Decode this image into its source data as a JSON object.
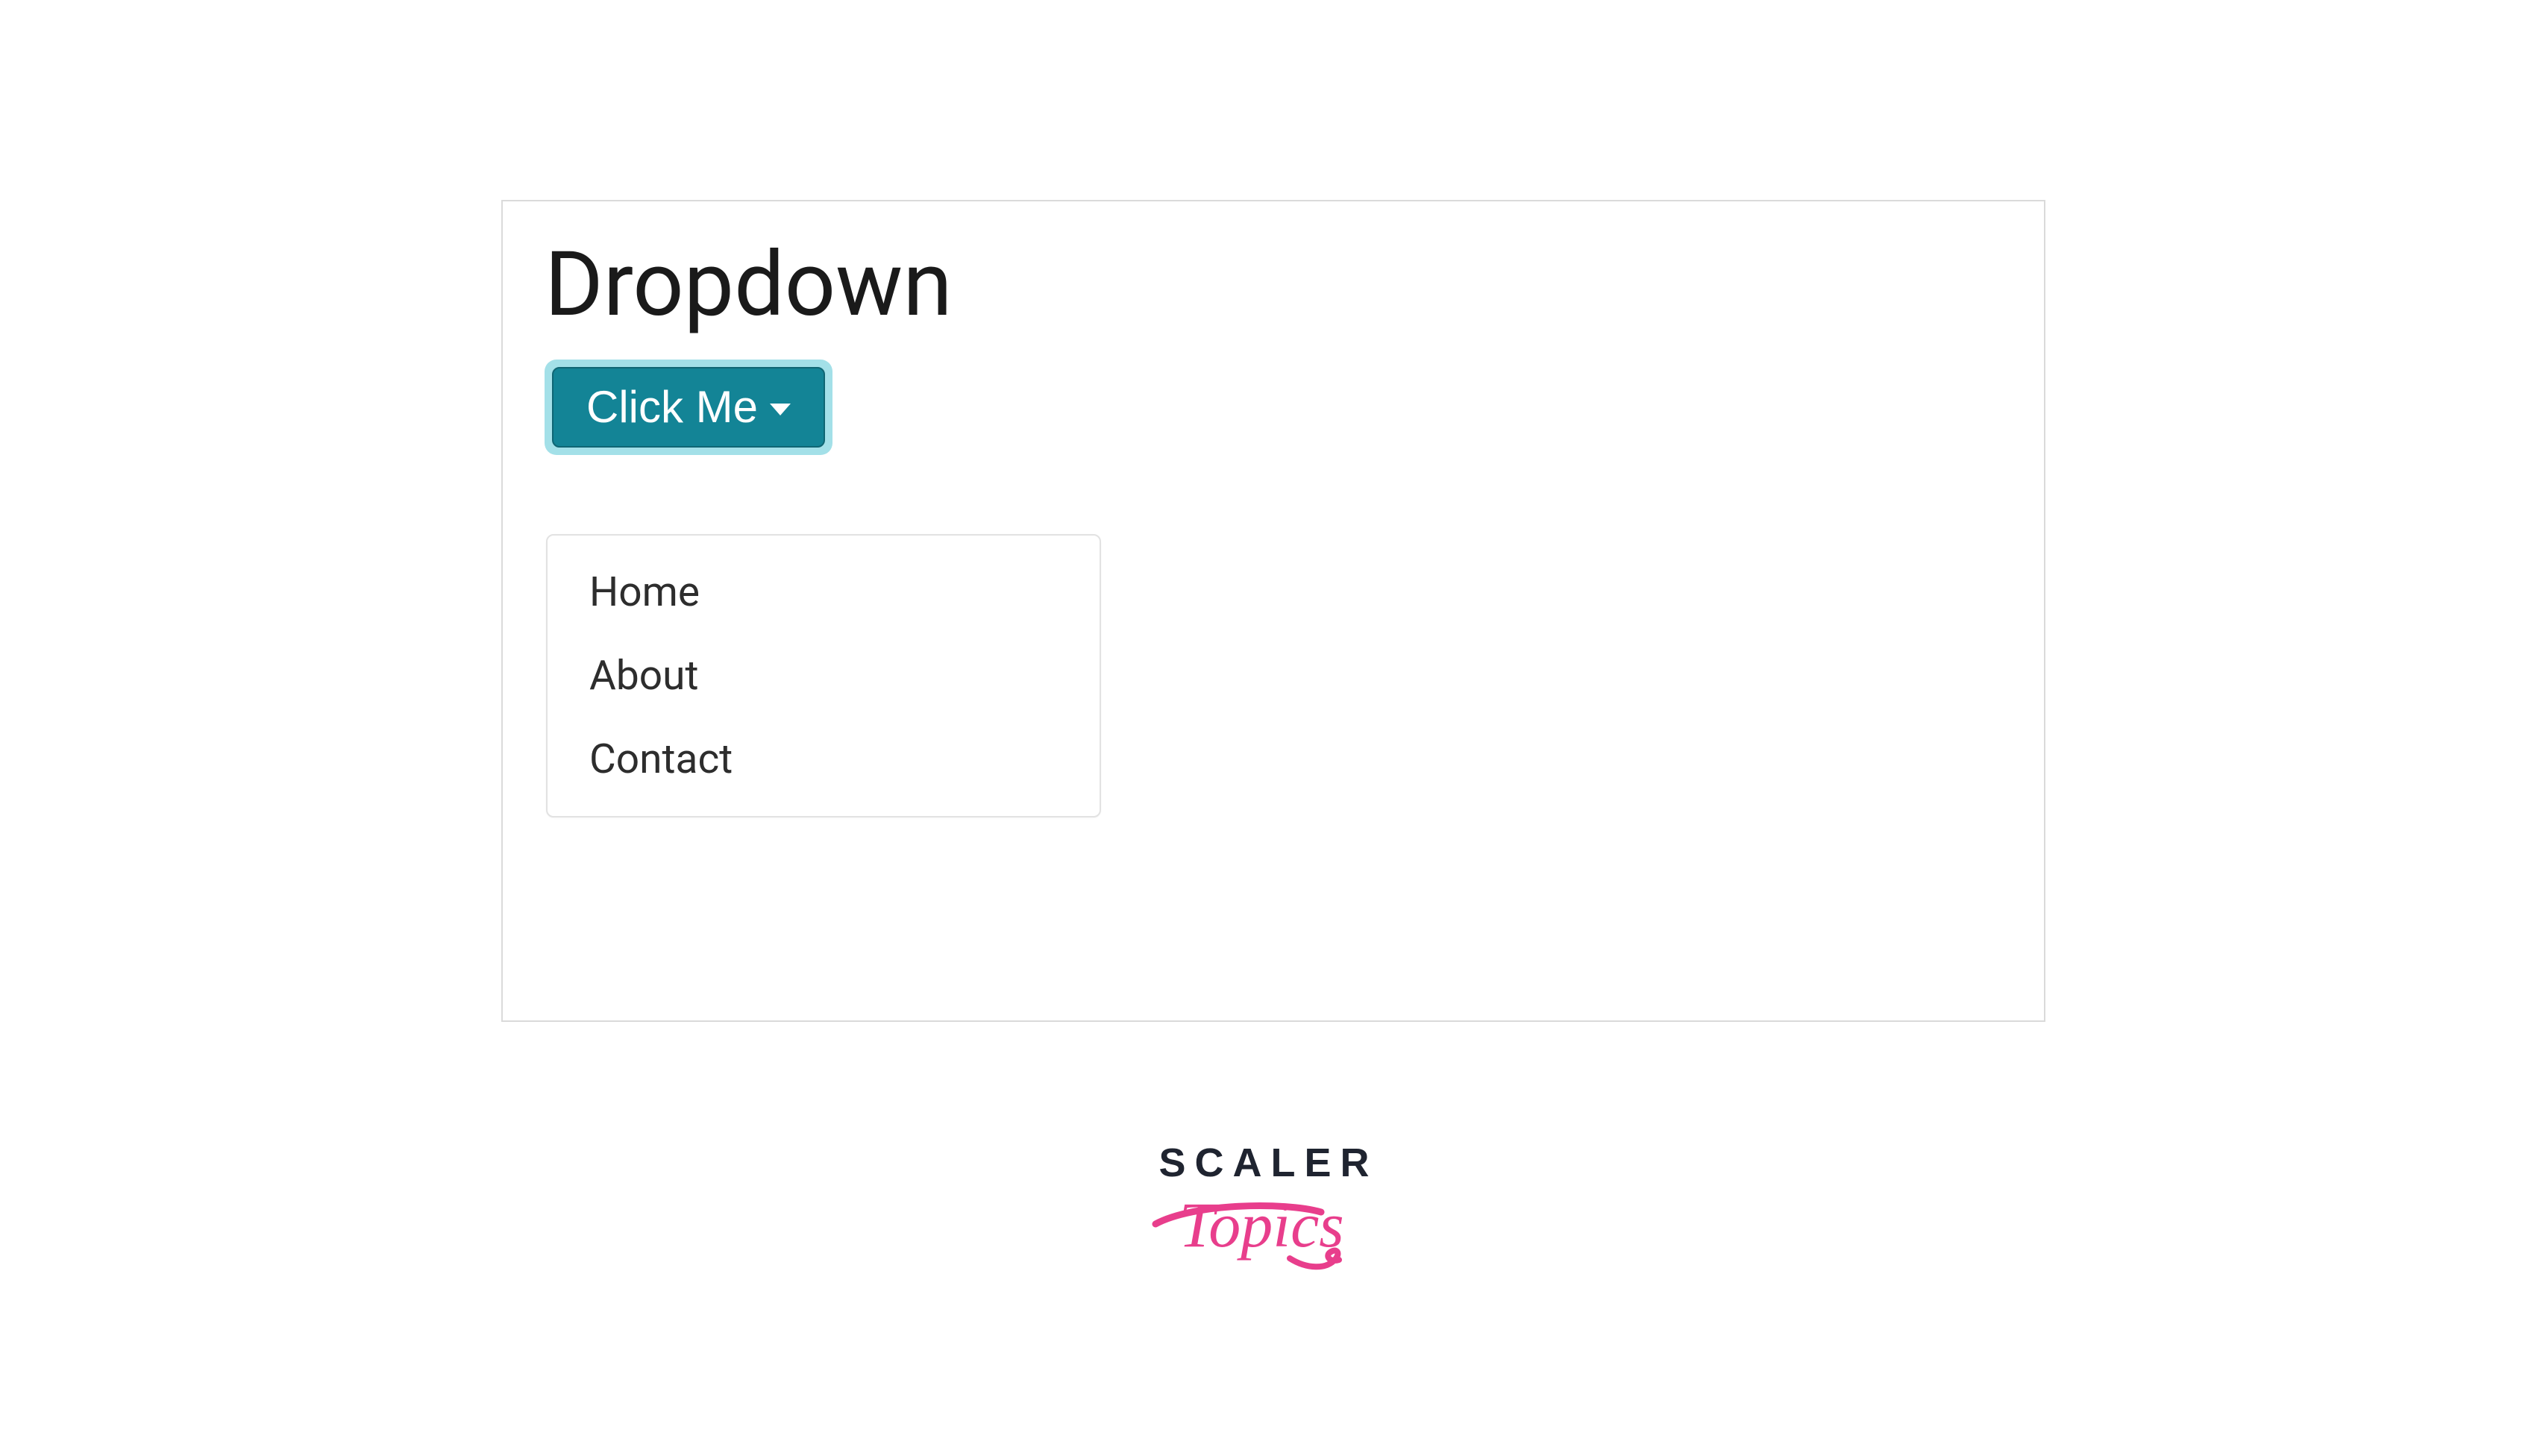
{
  "panel": {
    "heading": "Dropdown",
    "button_label": "Click Me",
    "menu": [
      "Home",
      "About",
      "Contact"
    ]
  },
  "branding": {
    "line1": "SCALER",
    "line2_text": "Topics"
  },
  "colors": {
    "button_bg": "#138496",
    "button_border": "#0f6674",
    "focus_ring": "#a3e0e8",
    "panel_border": "#dadada",
    "menu_border": "#e2e2e2",
    "brand_pink": "#e83e8c",
    "brand_navy": "#1f2430"
  }
}
